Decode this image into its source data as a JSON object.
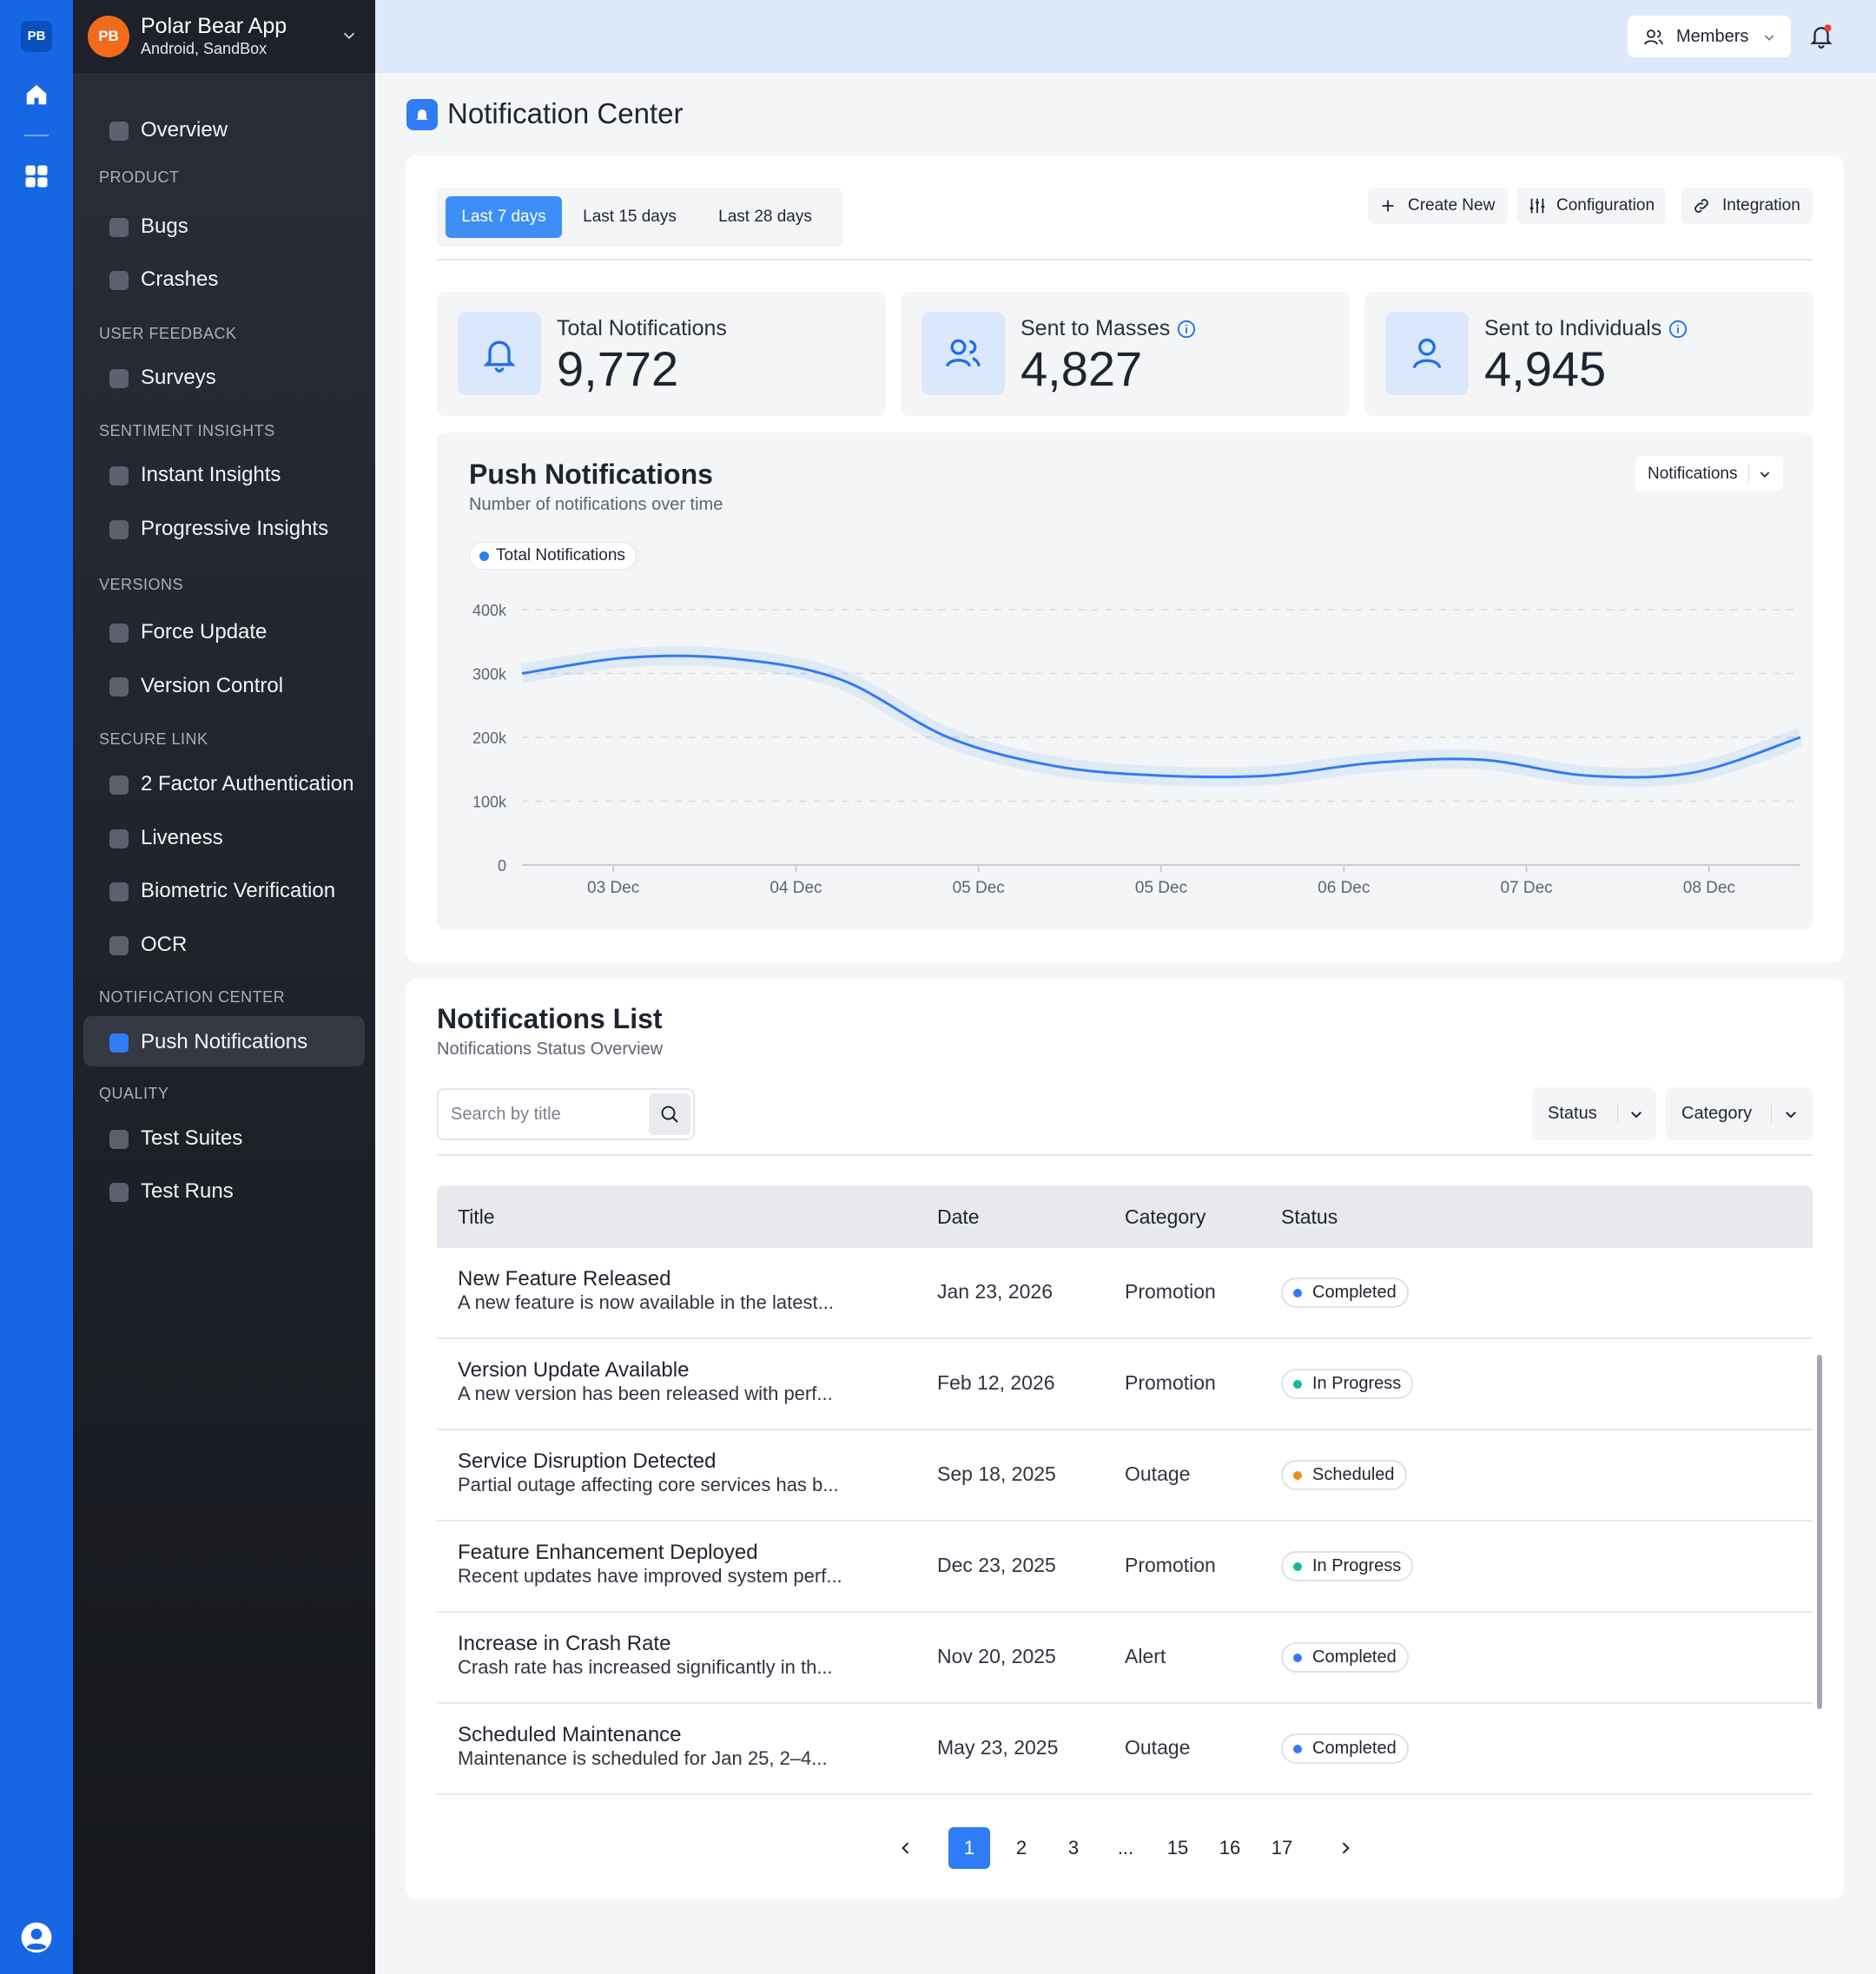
{
  "rail": {
    "logo": "PB",
    "icons": [
      "home-icon",
      "grid-icon",
      "user-circle-icon"
    ],
    "colors": {
      "rail": "#1766e6",
      "accent": "#2f7cf6"
    }
  },
  "org": {
    "avatar": "PB",
    "name": "Polar Bear App",
    "sub": "Android, SandBox"
  },
  "sidebar": {
    "overview": "Overview",
    "sections": {
      "product": "PRODUCT",
      "user_feedback": "USER FEEDBACK",
      "sentiment": "SENTIMENT INSIGHTS",
      "versions": "VERSIONS",
      "secure_link": "SECURE LINK",
      "notification_center": "NOTIFICATION CENTER",
      "quality": "QUALITY"
    },
    "items": {
      "bugs": "Bugs",
      "crashes": "Crashes",
      "surveys": "Surveys",
      "instant_insights": "Instant Insights",
      "progressive_insights": "Progressive Insights",
      "force_update": "Force Update",
      "version_control": "Version Control",
      "two_factor": "2 Factor Authentication",
      "liveness": "Liveness",
      "biometric": "Biometric Verification",
      "ocr": "OCR",
      "push_notifications": "Push Notifications",
      "test_suites": "Test Suites",
      "test_runs": "Test Runs"
    },
    "active": "push_notifications"
  },
  "topbar": {
    "members_label": "Members"
  },
  "page": {
    "title": "Notification Center"
  },
  "ranges": [
    "Last 7 days",
    "Last 15 days",
    "Last 28 days"
  ],
  "active_range": "Last 7 days",
  "actions": {
    "create": "Create New",
    "config": "Configuration",
    "integration": "Integration"
  },
  "stats": [
    {
      "label": "Total Notifications",
      "value": "9,772",
      "icon": "bell-icon"
    },
    {
      "label": "Sent to Masses",
      "value": "4,827",
      "icon": "users-icon"
    },
    {
      "label": "Sent to Individuals",
      "value": "4,945",
      "icon": "user-icon"
    }
  ],
  "chart_card": {
    "title": "Push Notifications",
    "subtitle": "Number of notifications over time",
    "dropdown": "Notifications"
  },
  "chart_data": {
    "type": "line",
    "title": "Push Notifications",
    "subtitle": "Number of notifications over time",
    "series": [
      {
        "name": "Total Notifications",
        "color": "#2f7cf6",
        "values": [
          300000,
          325000,
          323000,
          290000,
          200000,
          155000,
          140000,
          140000,
          160000,
          165000,
          140000,
          145000,
          200000
        ]
      }
    ],
    "x_ticks": [
      "03 Dec",
      "04 Dec",
      "05 Dec",
      "05 Dec",
      "06 Dec",
      "07 Dec",
      "08 Dec"
    ],
    "y_ticks": [
      "0",
      "100k",
      "200k",
      "300k",
      "400k"
    ],
    "ylim": [
      0,
      400000
    ],
    "grid": true,
    "legend_position": "top-left"
  },
  "list": {
    "title": "Notifications List",
    "subtitle": "Notifications Status Overview",
    "search_placeholder": "Search by title",
    "filters": {
      "status": "Status",
      "category": "Category"
    },
    "columns": [
      "Title",
      "Date",
      "Category",
      "Status"
    ],
    "rows": [
      {
        "title": "New Feature Released",
        "desc": "A new feature is now available in the latest...",
        "date": "Jan 23, 2026",
        "category": "Promotion",
        "status": "Completed",
        "status_color": "#2f7cf6"
      },
      {
        "title": "Version Update Available",
        "desc": "A new version has been released with perf...",
        "date": "Feb 12, 2026",
        "category": "Promotion",
        "status": "In Progress",
        "status_color": "#16b89a"
      },
      {
        "title": "Service Disruption Detected",
        "desc": "Partial outage affecting core services has b...",
        "date": "Sep 18, 2025",
        "category": "Outage",
        "status": "Scheduled",
        "status_color": "#f08a17"
      },
      {
        "title": "Feature Enhancement Deployed",
        "desc": "Recent updates have improved system perf...",
        "date": "Dec 23, 2025",
        "category": "Promotion",
        "status": "In Progress",
        "status_color": "#16b89a"
      },
      {
        "title": "Increase in Crash Rate",
        "desc": "Crash rate has increased significantly in th...",
        "date": "Nov 20, 2025",
        "category": "Alert",
        "status": "Completed",
        "status_color": "#2f7cf6"
      },
      {
        "title": "Scheduled Maintenance",
        "desc": "Maintenance is scheduled for Jan 25, 2–4...",
        "date": "May 23, 2025",
        "category": "Outage",
        "status": "Completed",
        "status_color": "#2f7cf6"
      }
    ]
  },
  "pagination": {
    "pages": [
      "1",
      "2",
      "3",
      "...",
      "15",
      "16",
      "17"
    ],
    "active": "1"
  }
}
